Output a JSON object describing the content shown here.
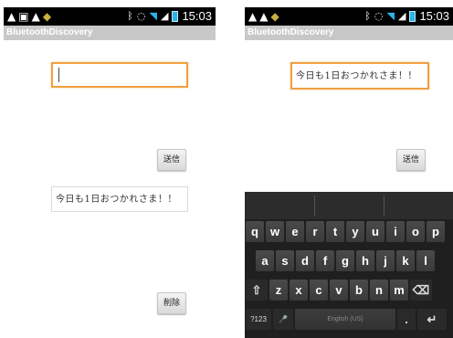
{
  "left_screen": {
    "status_time": "15:03",
    "app_title": "BluetoothDiscovery",
    "input_value": "",
    "send_label": "送信",
    "received_text": "今日も1日おつかれさま！！",
    "delete_label": "削除"
  },
  "right_screen": {
    "status_time": "15:03",
    "app_title": "BluetoothDiscovery",
    "input_value": "今日も1日おつかれさま！！",
    "send_label": "送信",
    "keyboard": {
      "row1": [
        "q",
        "w",
        "e",
        "r",
        "t",
        "y",
        "u",
        "i",
        "o",
        "p"
      ],
      "row2": [
        "a",
        "s",
        "d",
        "f",
        "g",
        "h",
        "j",
        "k",
        "l"
      ],
      "row3": [
        "z",
        "x",
        "c",
        "v",
        "b",
        "n",
        "m"
      ],
      "shift_icon": "⇧",
      "backspace_icon": "⌫",
      "symbols_key": "?123",
      "mic_icon": "🎤",
      "space_label": "English (US)",
      "period_key": ".",
      "enter_icon": "↵"
    }
  },
  "colors": {
    "status_bar": "#000000",
    "title_bar": "#c8c8c8",
    "focus_border": "#f0a040",
    "keyboard_bg": "#1f1f1f",
    "battery": "#2bb3e6"
  },
  "icons": {
    "status_left": [
      "warning-icon",
      "image-icon",
      "warning-icon",
      "android-icon"
    ],
    "status_right": [
      "bluetooth-icon",
      "sync-icon",
      "wifi-icon",
      "signal-icon",
      "battery-icon"
    ]
  }
}
